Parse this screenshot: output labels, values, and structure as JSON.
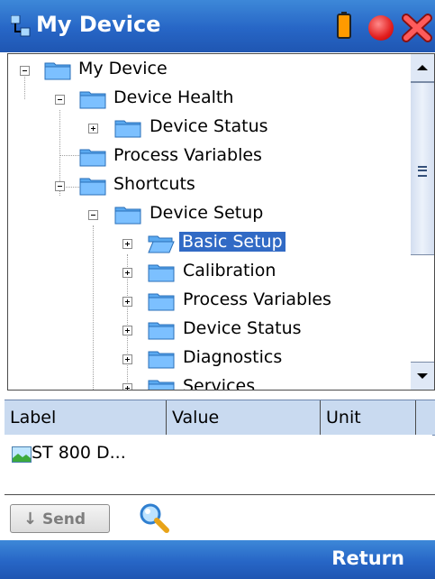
{
  "app": {
    "title": "My Device",
    "colors": {
      "titlebar": "#2766c6",
      "selection": "#316ac5",
      "grid_header": "#c9daf0"
    }
  },
  "tree": {
    "items": [
      {
        "label": "My Device",
        "expander": "minus",
        "icon": "folder-icon"
      },
      {
        "label": "Device Health",
        "expander": "minus",
        "icon": "folder-icon"
      },
      {
        "label": "Device Status",
        "expander": "plus",
        "icon": "folder-icon"
      },
      {
        "label": "Process Variables",
        "expander": "none",
        "icon": "folder-icon"
      },
      {
        "label": "Shortcuts",
        "expander": "minus",
        "icon": "folder-icon"
      },
      {
        "label": "Device Setup",
        "expander": "minus",
        "icon": "folder-icon"
      },
      {
        "label": "Basic Setup",
        "expander": "plus",
        "icon": "open-folder-icon",
        "selected": true
      },
      {
        "label": "Calibration",
        "expander": "plus",
        "icon": "folder-icon"
      },
      {
        "label": "Process Variables",
        "expander": "plus",
        "icon": "folder-icon"
      },
      {
        "label": "Device Status",
        "expander": "plus",
        "icon": "folder-icon"
      },
      {
        "label": "Diagnostics",
        "expander": "plus",
        "icon": "folder-icon"
      },
      {
        "label": "Services",
        "expander": "plus",
        "icon": "folder-icon"
      }
    ]
  },
  "grid": {
    "columns": [
      "Label",
      "Value",
      "Unit"
    ],
    "rows": [
      {
        "label": "ST 800 D...",
        "value": "",
        "unit": ""
      }
    ]
  },
  "toolbar": {
    "send_label": "Send",
    "send_arrow": "↓"
  },
  "bottom": {
    "return_label": "Return"
  }
}
